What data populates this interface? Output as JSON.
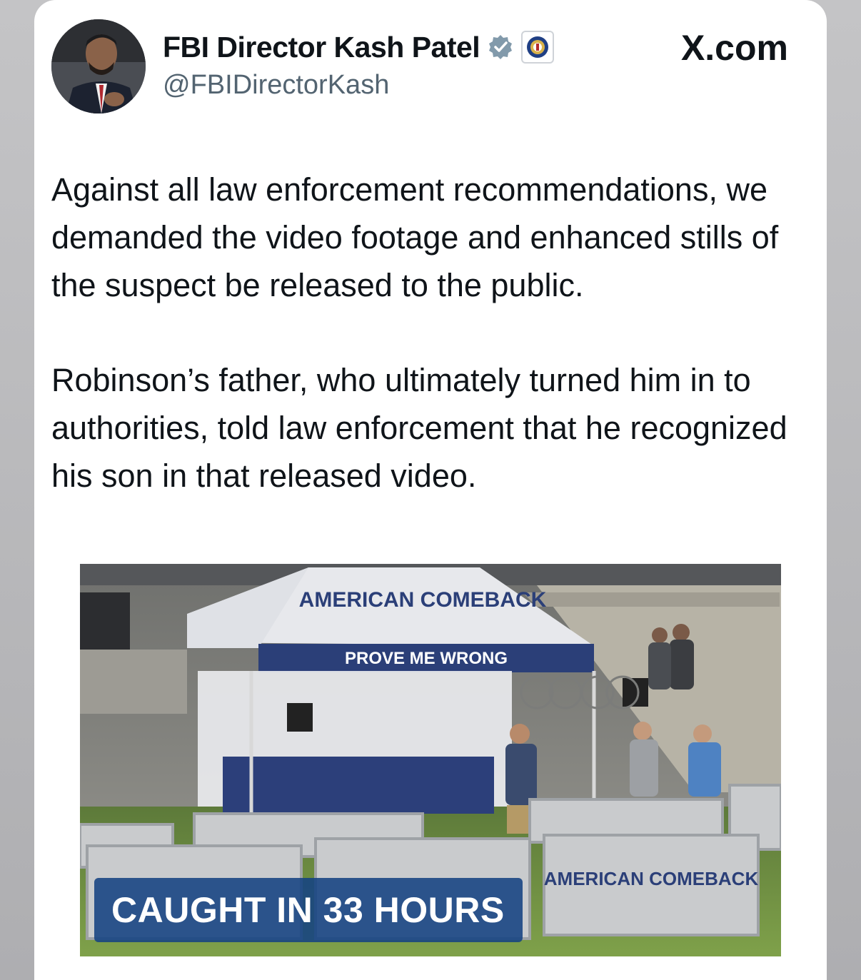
{
  "post": {
    "author_name": "FBI Director Kash Patel",
    "handle": "@FBIDirectorKash",
    "site": "X.com",
    "paragraphs": [
      "Against all law enforcement recommendations, we demanded the video footage and enhanced stills of the suspect be released to the public.",
      "Robinson’s father, who ultimately turned him in to authorities, told law enforcement that he recognized his son in that released video."
    ]
  },
  "media": {
    "caption": "CAUGHT IN 33 HOURS",
    "tent_banner_title": "AMERICAN COMEBACK",
    "tent_banner_strip": "PROVE ME WRONG"
  },
  "icons": {
    "verified": "verified-badge-icon",
    "affiliation": "fbi-seal-icon",
    "site_logo": "x-logo-icon"
  },
  "colors": {
    "verified_badge": "#829aab",
    "caption_bg": "#144282",
    "handle_text": "#536471"
  }
}
